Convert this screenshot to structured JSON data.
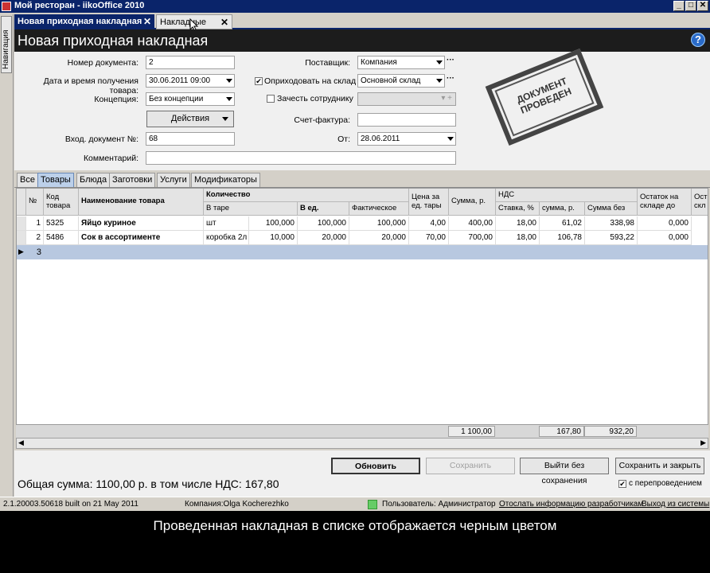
{
  "window": {
    "title": "Мой ресторан - iikoOffice 2010"
  },
  "nav": {
    "label": "Навигация"
  },
  "doc_tabs": [
    {
      "label": "Новая приходная накладная",
      "close": "✕"
    },
    {
      "label": "Накладные",
      "close": "✕"
    }
  ],
  "header": {
    "title": "Новая приходная накладная",
    "help": "?"
  },
  "form": {
    "doc_number_label": "Номер документа:",
    "doc_number": "2",
    "datetime_label": "Дата и время получения товара:",
    "datetime": "30.06.2011 09:00",
    "concept_label": "Концепция:",
    "concept": "Без концепции",
    "actions_label": "Действия",
    "incoming_label": "Вход. документ №:",
    "incoming": "68",
    "comment_label": "Комментарий:",
    "comment": "",
    "supplier_label": "Поставщик:",
    "supplier": "Компания",
    "post_label": "Оприходовать на склад",
    "post_checked": "✔",
    "warehouse": "Основной склад",
    "employee_label": "Зачесть сотруднику",
    "employee": "",
    "invoice_label": "Счет-фактура:",
    "invoice": "",
    "from_label": "От:",
    "from": "28.06.2011"
  },
  "stamp": {
    "line1": "ДОКУМЕНТ",
    "line2": "ПРОВЕДЕН"
  },
  "grid_tabs": [
    "Все",
    "Товары",
    "Блюда",
    "Заготовки",
    "Услуги",
    "Модификаторы"
  ],
  "table": {
    "headers": {
      "num": "№",
      "code": "Код товара",
      "name": "Наименование товара",
      "qty": "Количество",
      "in_pack": "В таре",
      "in_units": "В ед.",
      "actual": "Фактическое",
      "price": "Цена за ед. тары",
      "sum": "Сумма, р.",
      "vat": "НДС",
      "vat_rate": "Ставка, %",
      "vat_sum": "сумма, р.",
      "sum_wo": "Сумма без",
      "rest": "Остаток на складе до",
      "rest2": "Ост скл"
    },
    "rows": [
      {
        "n": "1",
        "code": "5325",
        "name": "Яйцо куриное",
        "pack": "шт",
        "pack_qty": "100,000",
        "units": "100,000",
        "actual": "100,000",
        "price": "4,00",
        "sum": "400,00",
        "rate": "18,00",
        "vat": "61,02",
        "wo": "338,98",
        "rest": "0,000"
      },
      {
        "n": "2",
        "code": "5486",
        "name": "Сок в ассортименте",
        "pack": "коробка 2л",
        "pack_qty": "10,000",
        "units": "20,000",
        "actual": "20,000",
        "price": "70,00",
        "sum": "700,00",
        "rate": "18,00",
        "vat": "106,78",
        "wo": "593,22",
        "rest": "0,000"
      }
    ],
    "new_row": "3",
    "footer": {
      "sum": "1 100,00",
      "vat": "167,80",
      "wo": "932,20"
    }
  },
  "buttons": {
    "refresh": "Обновить",
    "save": "Сохранить",
    "exit": "Выйти без сохранения",
    "save_close": "Сохранить и закрыть",
    "with_post": "с перепроведением",
    "with_post_checked": "✔"
  },
  "total": "Общая сумма: 1100,00 р. в том числе НДС: 167,80",
  "status": {
    "build": "2.1.20003.50618 built on 21 May 2011",
    "company": "Компания:Olga Kocherezhko",
    "user": "Пользователь: Администратор",
    "send": "Отослать информацию разработчикам",
    "exit": "Выход из системы"
  },
  "caption": "Проведенная накладная в списке отображается черным цветом"
}
